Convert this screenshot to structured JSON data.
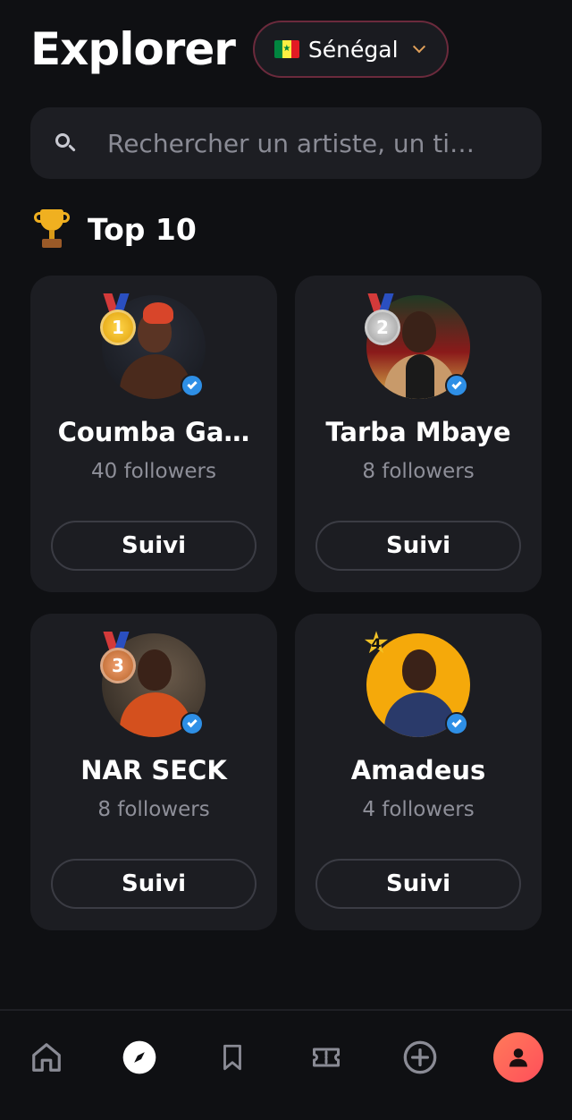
{
  "header": {
    "title": "Explorer",
    "country": {
      "label": "Sénégal",
      "flag": "senegal-flag-icon"
    }
  },
  "search": {
    "placeholder": "Rechercher un artiste, un ti…",
    "value": ""
  },
  "section": {
    "icon": "trophy-icon",
    "title": "Top 10"
  },
  "artists": [
    {
      "rank": 1,
      "name": "Coumba Ga…",
      "followers": "40 followers",
      "button": "Suivi",
      "verified": true,
      "badge": "gold-medal-icon"
    },
    {
      "rank": 2,
      "name": "Tarba Mbaye",
      "followers": "8 followers",
      "button": "Suivi",
      "verified": true,
      "badge": "silver-medal-icon"
    },
    {
      "rank": 3,
      "name": "NAR SECK",
      "followers": "8 followers",
      "button": "Suivi",
      "verified": true,
      "badge": "bronze-medal-icon"
    },
    {
      "rank": 4,
      "name": "Amadeus",
      "followers": "4 followers",
      "button": "Suivi",
      "verified": true,
      "badge": "rank-star-icon"
    }
  ],
  "badges": {
    "rank1": "1",
    "rank2": "2",
    "rank3": "3",
    "rank4": "4"
  },
  "nav": {
    "items": [
      "home-icon",
      "explore-compass-icon",
      "bookmark-icon",
      "ticket-icon",
      "add-circle-icon",
      "profile-icon"
    ],
    "active": "explore-compass-icon"
  },
  "colors": {
    "background": "#0f1013",
    "card": "#1c1d22",
    "accent": "#ff5f5a",
    "verified": "#2e8fe6",
    "muted_text": "#8e8f99"
  }
}
